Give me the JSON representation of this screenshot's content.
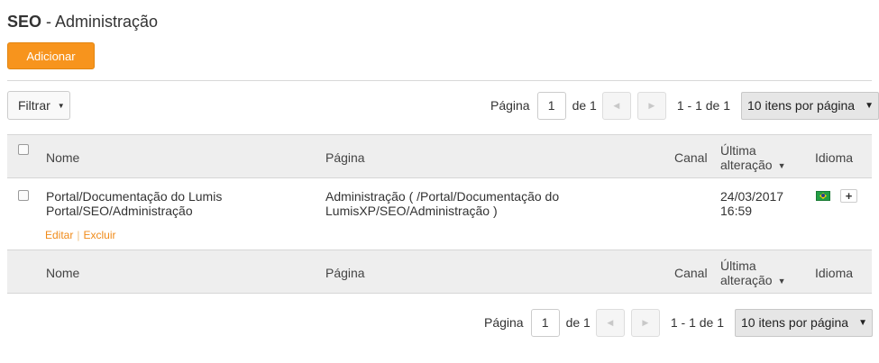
{
  "header": {
    "title_bold": "SEO",
    "title_rest": " - Administração"
  },
  "toolbar": {
    "add_label": "Adicionar",
    "filter_label": "Filtrar",
    "filter_icon": "caret-down-icon"
  },
  "pagination_top": {
    "page_label": "Página",
    "page_value": "1",
    "of_label": "de 1",
    "prev_icon": "chevron-left-icon",
    "next_icon": "chevron-right-icon",
    "range": "1 - 1 de 1",
    "per_page": "10 itens por página"
  },
  "pagination_bottom": {
    "page_label": "Página",
    "page_value": "1",
    "of_label": "de 1",
    "range": "1 - 1 de 1",
    "per_page": "10 itens por página"
  },
  "table": {
    "columns": {
      "name": "Nome",
      "page": "Página",
      "channel": "Canal",
      "modified_1": "Última",
      "modified_2": "alteração",
      "language": "Idioma"
    },
    "rows": [
      {
        "name_1": "Portal/Documentação do Lumis",
        "name_2": "Portal/SEO/Administração",
        "page_1": "Administração ( /Portal/Documentação do",
        "page_2": "LumisXP/SEO/Administração )",
        "channel": "",
        "date": "24/03/2017",
        "time": "16:59",
        "flag": "brazil-flag-icon",
        "add_language": "+",
        "edit_label": "Editar",
        "separator": "|",
        "delete_label": "Excluir"
      }
    ]
  },
  "colors": {
    "accent": "#f7941d",
    "link": "#f08a18",
    "header_bg": "#eeeeee"
  }
}
